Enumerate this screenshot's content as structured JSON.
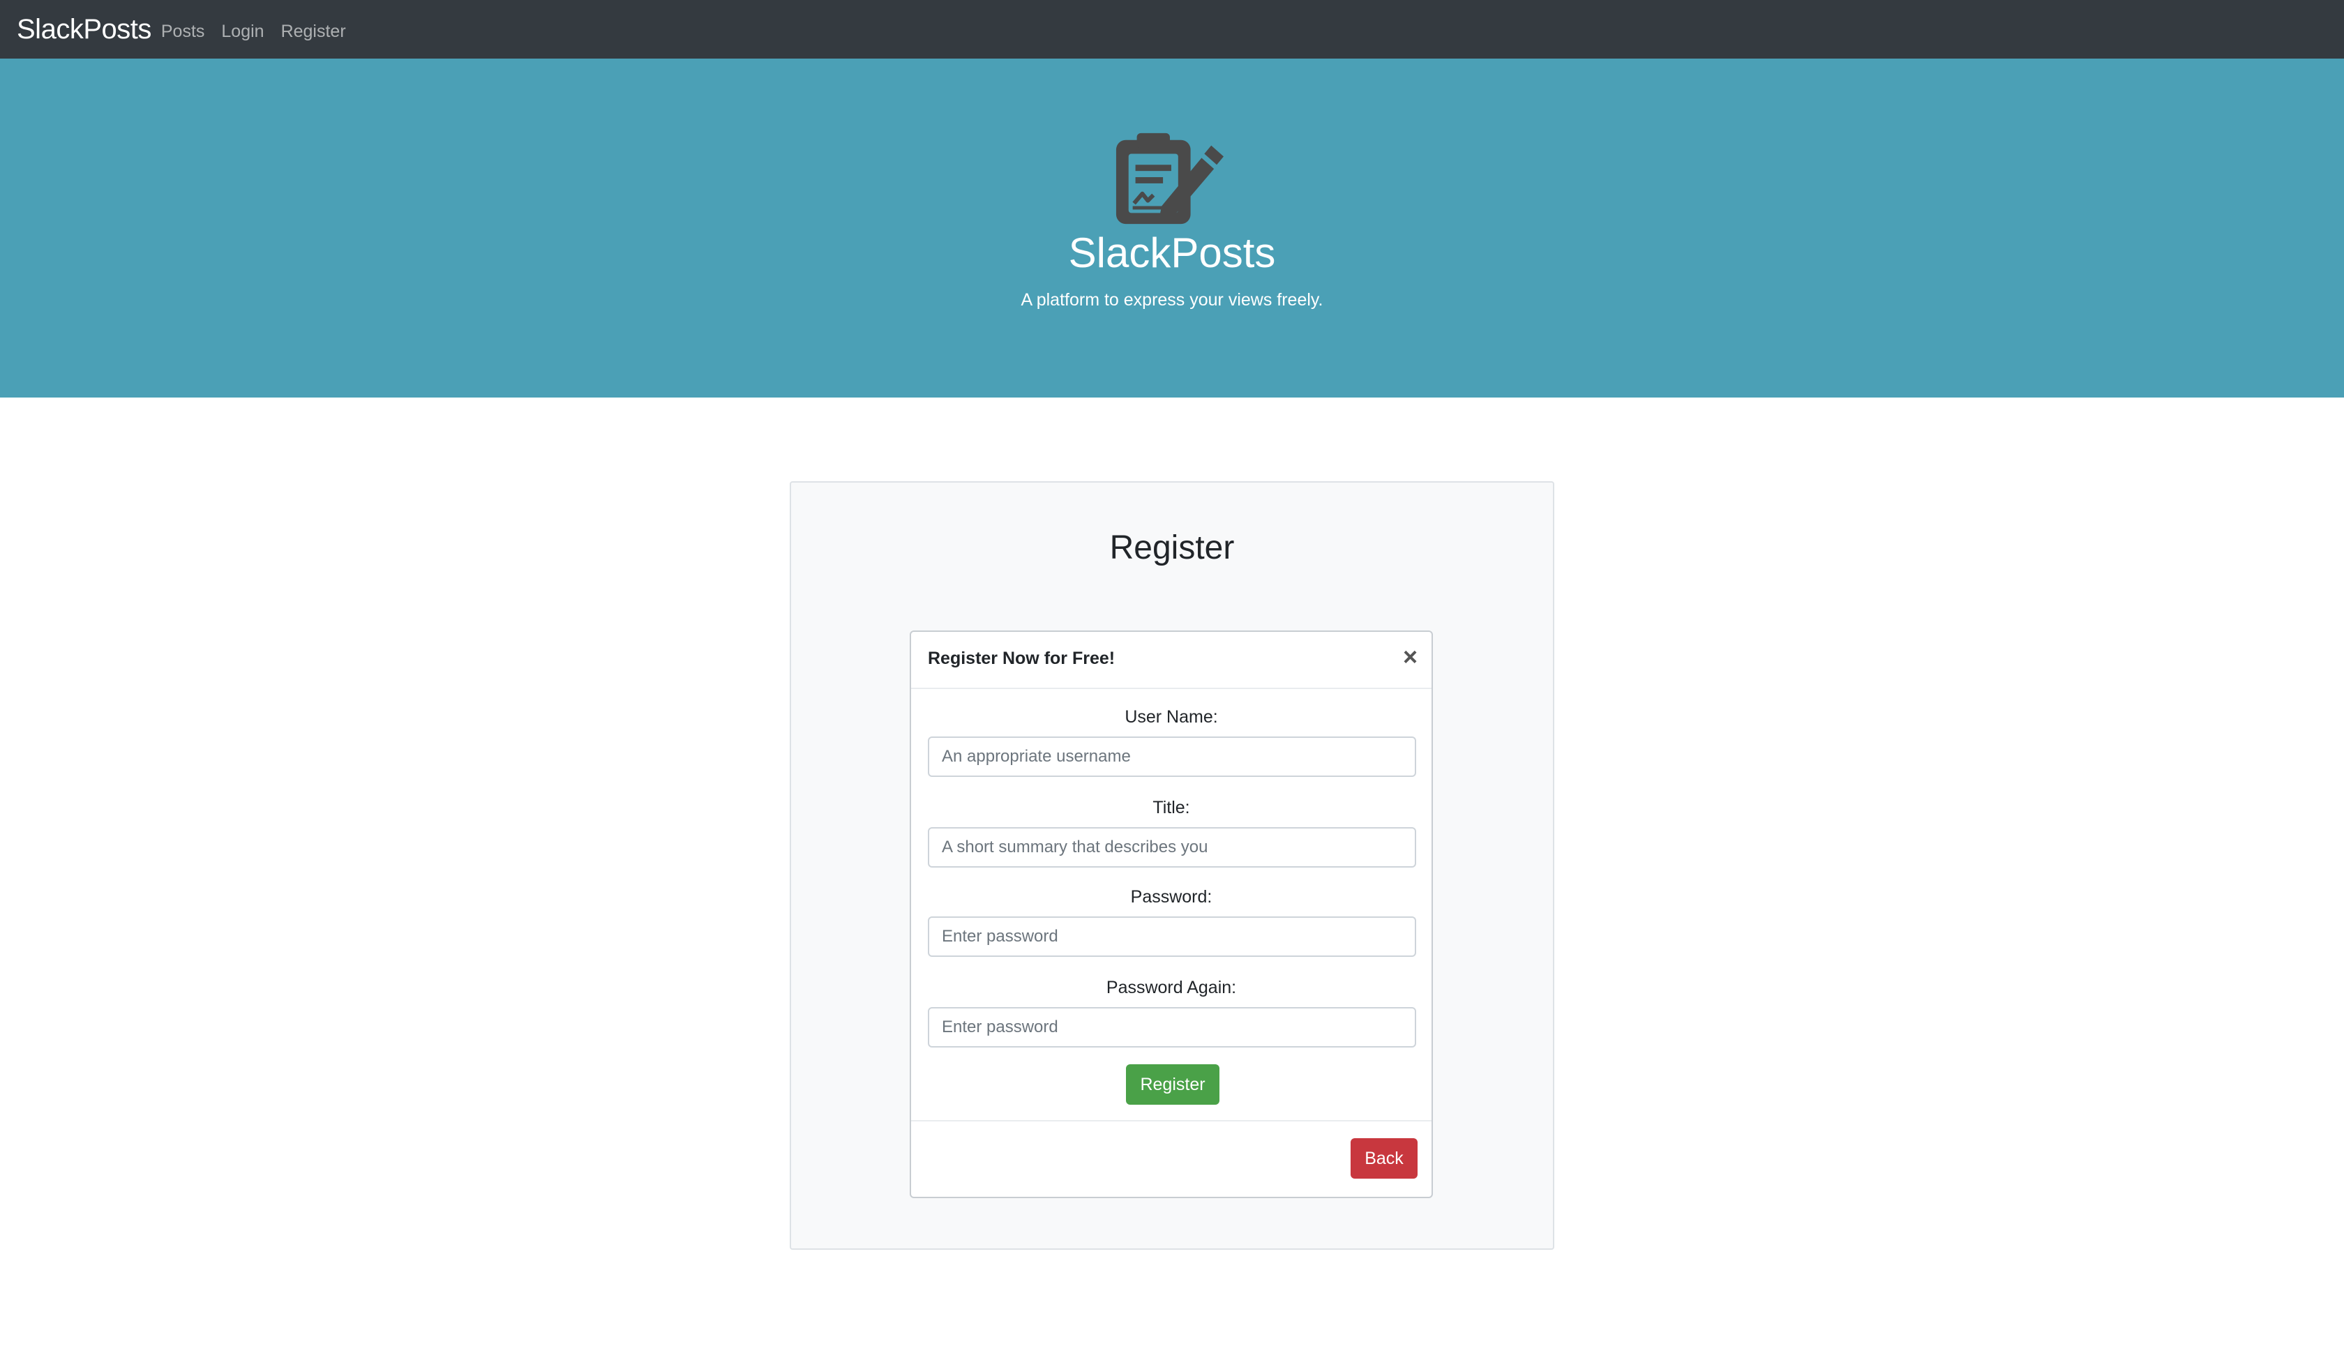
{
  "navbar": {
    "brand": "SlackPosts",
    "links": [
      "Posts",
      "Login",
      "Register"
    ]
  },
  "hero": {
    "icon": "signature-document-icon",
    "title": "SlackPosts",
    "subtitle": "A platform to express your views freely."
  },
  "card": {
    "title": "Register"
  },
  "modal": {
    "title": "Register Now for Free!",
    "close_label": "×",
    "fields": [
      {
        "label": "User Name:",
        "placeholder": "An appropriate username"
      },
      {
        "label": "Title:",
        "placeholder": "A short summary that describes you"
      },
      {
        "label": "Password:",
        "placeholder": "Enter password"
      },
      {
        "label": "Password Again:",
        "placeholder": "Enter password"
      }
    ],
    "submit_label": "Register",
    "back_label": "Back"
  },
  "colors": {
    "navbar": "#343a40",
    "hero": "#4ba0b6",
    "success": "#4aa148",
    "danger": "#c8373e"
  }
}
